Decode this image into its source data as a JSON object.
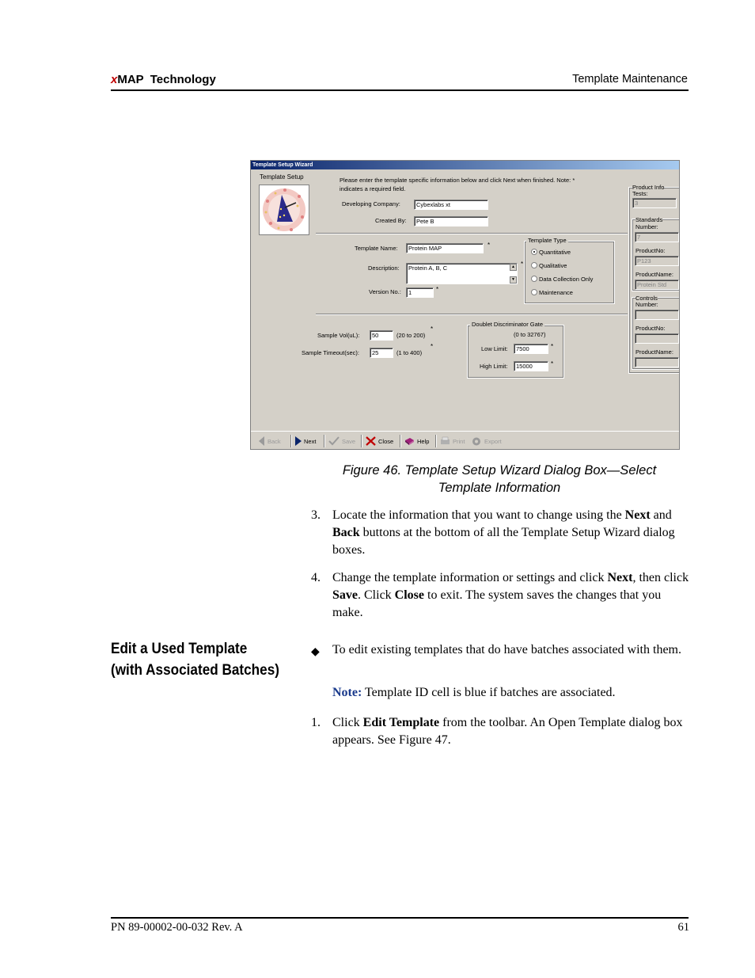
{
  "header": {
    "brand_x": "x",
    "brand_rest": "MAP  Technology",
    "section": "Template Maintenance"
  },
  "dialog": {
    "title": "Template Setup Wizard",
    "heading": "Template Setup",
    "instructions_1": "Please enter the template specific information below and click Next when finished.   Note: *",
    "instructions_2": "indicates a required field.",
    "developing_company_label": "Developing Company:",
    "developing_company_value": "Cybexlabs xt",
    "created_by_label": "Created By:",
    "created_by_value": "Pete B",
    "template_name_label": "Template Name:",
    "template_name_value": "Protein MAP",
    "description_label": "Description:",
    "description_value": "Protein A, B, C",
    "version_label": "Version No.:",
    "version_value": "1",
    "template_type": {
      "title": "Template Type",
      "options": [
        "Quantitative",
        "Qualitative",
        "Data Collection Only",
        "Maintenance"
      ]
    },
    "sample_vol_label": "Sample Vol(uL):",
    "sample_vol_value": "50",
    "sample_vol_range": "(20 to 200)",
    "sample_timeout_label": "Sample Timeout(sec):",
    "sample_timeout_value": "25",
    "sample_timeout_range": "(1 to 400)",
    "doublet": {
      "title": "Doublet Discriminator Gate",
      "range": "(0 to 32767)",
      "low_label": "Low Limit:",
      "low_value": "7500",
      "high_label": "High Limit:",
      "high_value": "15000"
    },
    "product_info": {
      "title": "Product Info",
      "tests_label": "Tests:",
      "tests_value": "3",
      "standards_title": "Standards",
      "standards_number_label": "Number:",
      "standards_number_value": "7",
      "standards_productno_label": "ProductNo:",
      "standards_productno_value": "P123",
      "standards_productname_label": "ProductName:",
      "standards_productname_value": "Protein Std",
      "controls_title": "Controls",
      "controls_number_label": "Number:",
      "controls_productno_label": "ProductNo:",
      "controls_productname_label": "ProductName:"
    },
    "toolbar": {
      "back": "Back",
      "next": "Next",
      "save": "Save",
      "close": "Close",
      "help": "Help",
      "print": "Print",
      "export": "Export"
    }
  },
  "caption_line1": "Figure 46.  Template Setup Wizard Dialog Box—Select",
  "caption_line2": "Template Information",
  "step3": {
    "num": "3.",
    "t1": "Locate the information that you want to change using the ",
    "b1": "Next",
    "t2": " and ",
    "b2": "Back",
    "t3": " buttons at the bottom of all the Template Setup Wizard dialog boxes."
  },
  "step4": {
    "num": "4.",
    "t1": "Change the template information or settings and click ",
    "b1": "Next",
    "t2": ", then click ",
    "b2": "Save",
    "t3": ". Click ",
    "b3": "Close",
    "t4": " to exit. The system saves the changes that you make."
  },
  "section_heading_1": "Edit a Used Template",
  "section_heading_2": "(with Associated Batches)",
  "bullet_text": "To edit existing templates that do have batches associated with them.",
  "note_label": "Note:",
  "note_text": " Template ID cell is blue if batches are associated.",
  "step1": {
    "num": "1.",
    "t1": "Click ",
    "b1": "Edit Template",
    "t2": " from the toolbar. An Open Template dialog box appears. See Figure 47."
  },
  "footer": {
    "part_number": "PN 89-00002-00-032 Rev. A",
    "page": "61"
  }
}
